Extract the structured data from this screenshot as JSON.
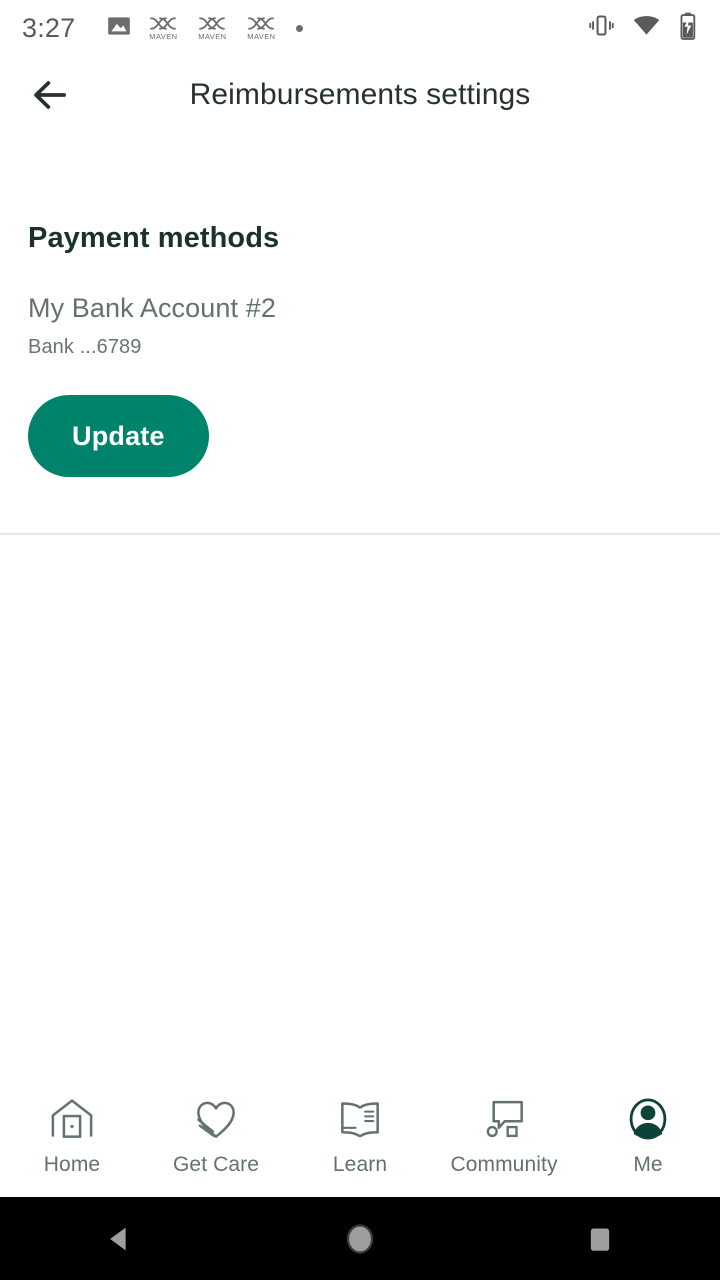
{
  "status_bar": {
    "time": "3:27",
    "icons": [
      {
        "name": "photo-icon",
        "label": ""
      },
      {
        "name": "maven-notification-icon-1",
        "label": "MAVEN"
      },
      {
        "name": "maven-notification-icon-2",
        "label": "MAVEN"
      },
      {
        "name": "maven-notification-icon-3",
        "label": "MAVEN"
      },
      {
        "name": "more-notifications-dot",
        "label": ""
      }
    ],
    "right_icons": [
      {
        "name": "vibrate-icon"
      },
      {
        "name": "wifi-icon"
      },
      {
        "name": "battery-charging-icon"
      }
    ]
  },
  "header": {
    "back_label": "Back",
    "title": "Reimbursements settings"
  },
  "main": {
    "section_title": "Payment methods",
    "payment_method": {
      "name": "My Bank Account #2",
      "details": "Bank ...6789"
    },
    "update_label": "Update"
  },
  "bottom_nav": {
    "items": [
      {
        "label": "Home",
        "icon": "home-icon",
        "active": false
      },
      {
        "label": "Get Care",
        "icon": "heart-hand-icon",
        "active": false
      },
      {
        "label": "Learn",
        "icon": "open-book-icon",
        "active": false
      },
      {
        "label": "Community",
        "icon": "speech-bubble-icon",
        "active": false
      },
      {
        "label": "Me",
        "icon": "profile-avatar-icon",
        "active": true
      }
    ]
  },
  "android_nav": {
    "back": "back-triangle",
    "home": "home-circle",
    "recents": "recents-square"
  },
  "colors": {
    "accent_green": "#00836b",
    "active_nav_green": "#0d4238",
    "heading": "#1b3226",
    "muted_text": "#63726b",
    "divider": "#e6e9ea"
  }
}
